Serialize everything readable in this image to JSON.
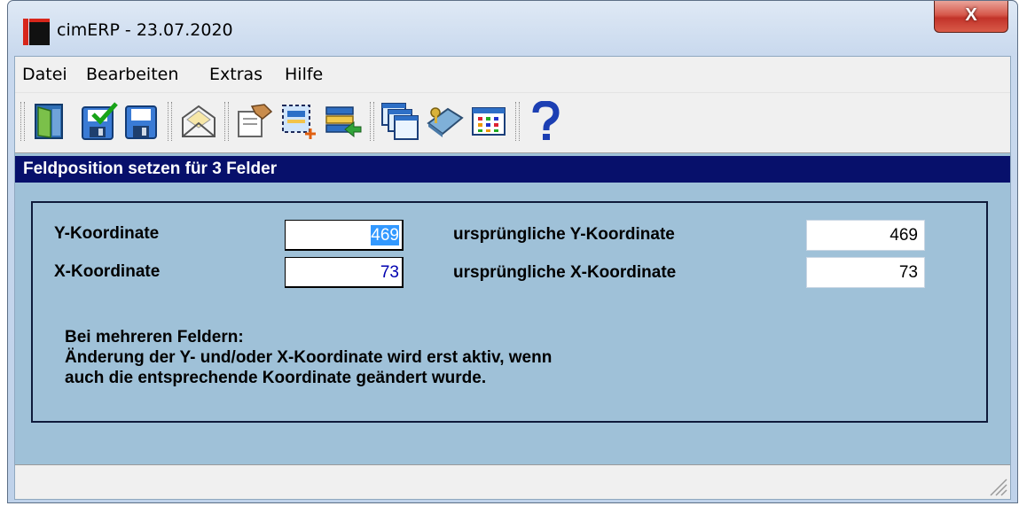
{
  "window": {
    "title": "cimERP - 23.07.2020",
    "close_label": "X"
  },
  "menu": [
    "Datei",
    "Bearbeiten",
    "Extras",
    "Hilfe"
  ],
  "toolbar": {
    "buttons": [
      "exit-door-icon",
      "save-check-icon",
      "save-icon",
      "mail-envelope-icon",
      "hand-card-icon",
      "new-field-icon",
      "list-import-icon",
      "windows-cascade-icon",
      "book-key-icon",
      "grid-table-icon",
      "help-icon"
    ]
  },
  "dialog": {
    "header": "Feldposition setzen für 3 Felder",
    "y_label": "Y-Koordinate",
    "y_value": "469",
    "x_label": "X-Koordinate",
    "x_value": "73",
    "orig_y_label": "ursprüngliche Y-Koordinate",
    "orig_y_value": "469",
    "orig_x_label": "ursprüngliche X-Koordinate",
    "orig_x_value": "73",
    "note_lines": [
      "Bei mehreren Feldern:",
      "Änderung der Y- und/oder X-Koordinate wird erst aktiv, wenn",
      "auch die entsprechende Koordinate geändert wurde."
    ]
  },
  "colors": {
    "header_bg": "#07106b",
    "client_bg": "#9fc1d8",
    "selection": "#3399ff",
    "edit_text": "#0000b0"
  }
}
